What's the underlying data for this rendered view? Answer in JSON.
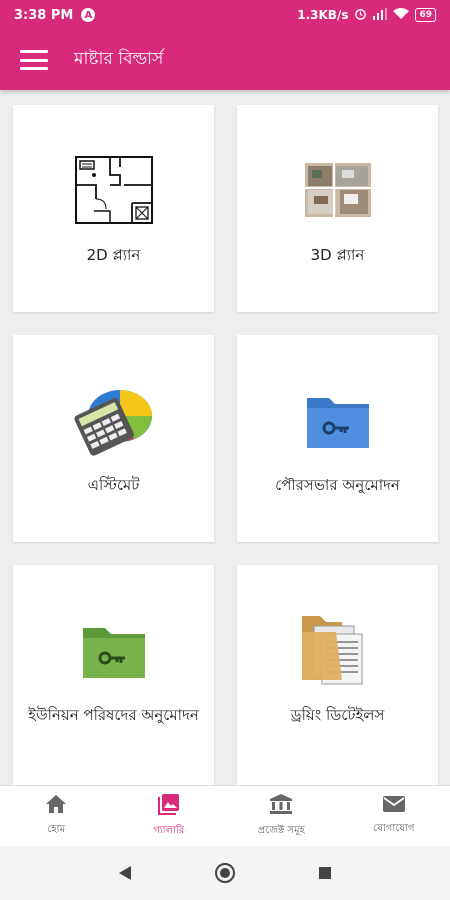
{
  "status": {
    "time": "3:38 PM",
    "badge": "A",
    "speed": "1.3KB/s",
    "battery": "69"
  },
  "app": {
    "title": "মাষ্টার বিল্ডার্স"
  },
  "cards": [
    {
      "label": "2D প্ল্যান",
      "icon": "floor-plan-2d-icon"
    },
    {
      "label": "3D প্ল্যান",
      "icon": "floor-plan-3d-icon"
    },
    {
      "label": "এস্টিমেট",
      "icon": "calculator-icon"
    },
    {
      "label": "পৌরসভার অনুমোদন",
      "icon": "blue-folder-key-icon"
    },
    {
      "label": "ইউনিয়ন পরিষদের অনুমোদন",
      "icon": "green-folder-key-icon"
    },
    {
      "label": "ড্রয়িং ডিটেইলস",
      "icon": "documents-folder-icon"
    }
  ],
  "bottom_nav": [
    {
      "label": "হোম",
      "icon": "home-icon"
    },
    {
      "label": "গ্যালারি",
      "icon": "gallery-icon",
      "active": true
    },
    {
      "label": "প্রজেক্ট সমূহ",
      "icon": "bank-icon"
    },
    {
      "label": "যোগাযোগ",
      "icon": "mail-icon"
    }
  ],
  "colors": {
    "primary": "#d8297a",
    "nav_inactive": "#666666"
  }
}
